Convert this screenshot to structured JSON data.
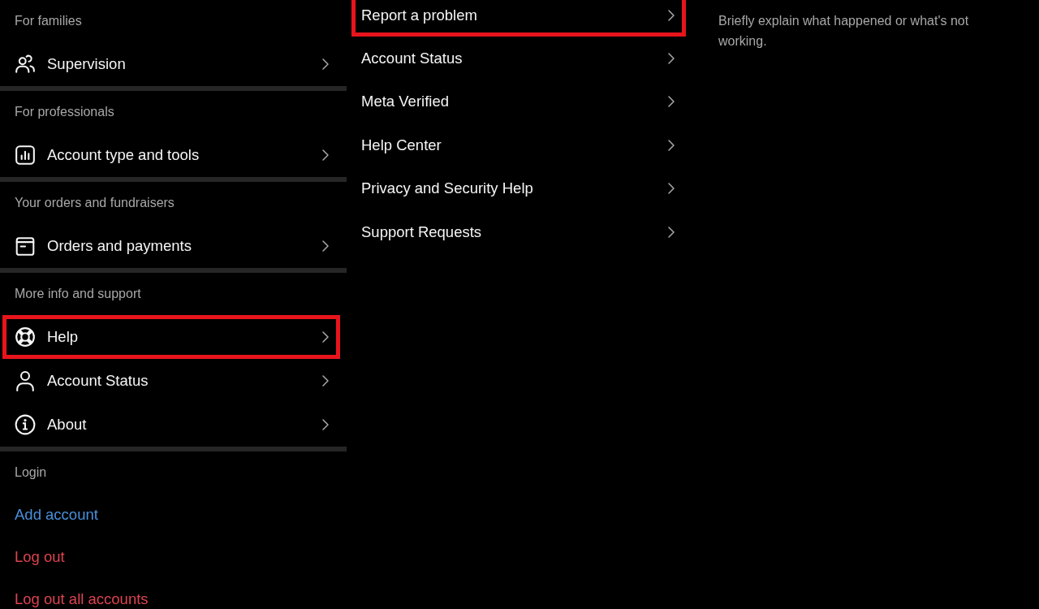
{
  "settings_menu": {
    "sections": [
      {
        "header": "For families",
        "items": [
          {
            "label": "Supervision",
            "kind": "nav",
            "highlighted": false
          }
        ]
      },
      {
        "header": "For professionals",
        "items": [
          {
            "label": "Account type and tools",
            "kind": "nav",
            "highlighted": false
          }
        ]
      },
      {
        "header": "Your orders and fundraisers",
        "items": [
          {
            "label": "Orders and payments",
            "kind": "nav",
            "highlighted": false
          }
        ]
      },
      {
        "header": "More info and support",
        "items": [
          {
            "label": "Help",
            "kind": "nav",
            "highlighted": true
          },
          {
            "label": "Account Status",
            "kind": "nav",
            "highlighted": false
          },
          {
            "label": "About",
            "kind": "nav",
            "highlighted": false
          }
        ]
      },
      {
        "header": "Login",
        "items": [
          {
            "label": "Add account",
            "kind": "link"
          },
          {
            "label": "Log out",
            "kind": "danger"
          },
          {
            "label": "Log out all accounts",
            "kind": "danger"
          }
        ]
      }
    ]
  },
  "help_menu": {
    "items": [
      {
        "label": "Report a problem",
        "highlighted": true
      },
      {
        "label": "Account Status",
        "highlighted": false
      },
      {
        "label": "Meta Verified",
        "highlighted": false
      },
      {
        "label": "Help Center",
        "highlighted": false
      },
      {
        "label": "Privacy and Security Help",
        "highlighted": false
      },
      {
        "label": "Support Requests",
        "highlighted": false
      }
    ]
  },
  "report_form": {
    "description": {
      "placeholder": "Briefly explain what happened or what's not working."
    }
  }
}
